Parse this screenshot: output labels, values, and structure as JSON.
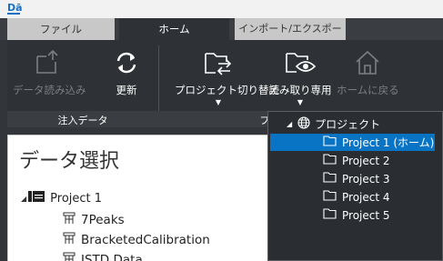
{
  "app": {
    "logo_text": "Dā"
  },
  "tabs": [
    {
      "label": "ファイル"
    },
    {
      "label": "ホーム"
    },
    {
      "label": "インポート/エクスポート"
    }
  ],
  "ribbon": {
    "buttons": [
      {
        "label": "データ読み込み",
        "enabled": false
      },
      {
        "label": "更新",
        "enabled": true
      },
      {
        "label": "プロジェクト切り替え",
        "enabled": true,
        "has_dropdown": true
      },
      {
        "label": "読み取り専用",
        "enabled": true,
        "has_dropdown": true
      },
      {
        "label": "ホームに戻る",
        "enabled": false
      }
    ],
    "groups": [
      {
        "label": "注入データ"
      },
      {
        "label": "プ"
      }
    ]
  },
  "data_panel": {
    "title": "データ選択",
    "tree": {
      "root_label": "Project 1",
      "items": [
        {
          "label": "7Peaks"
        },
        {
          "label": "BracketedCalibration"
        },
        {
          "label": "ISTD Data"
        }
      ]
    }
  },
  "project_dropdown": {
    "root_label": "プロジェクト",
    "items": [
      {
        "label": "Project 1 (ホーム)",
        "selected": true
      },
      {
        "label": "Project 2",
        "selected": false
      },
      {
        "label": "Project 3",
        "selected": false
      },
      {
        "label": "Project 4",
        "selected": false
      },
      {
        "label": "Project 5",
        "selected": false
      }
    ]
  },
  "colors": {
    "ribbon_bg": "#2e3236",
    "selected_item": "#0a74c4",
    "disabled_text": "#7b7f83"
  }
}
